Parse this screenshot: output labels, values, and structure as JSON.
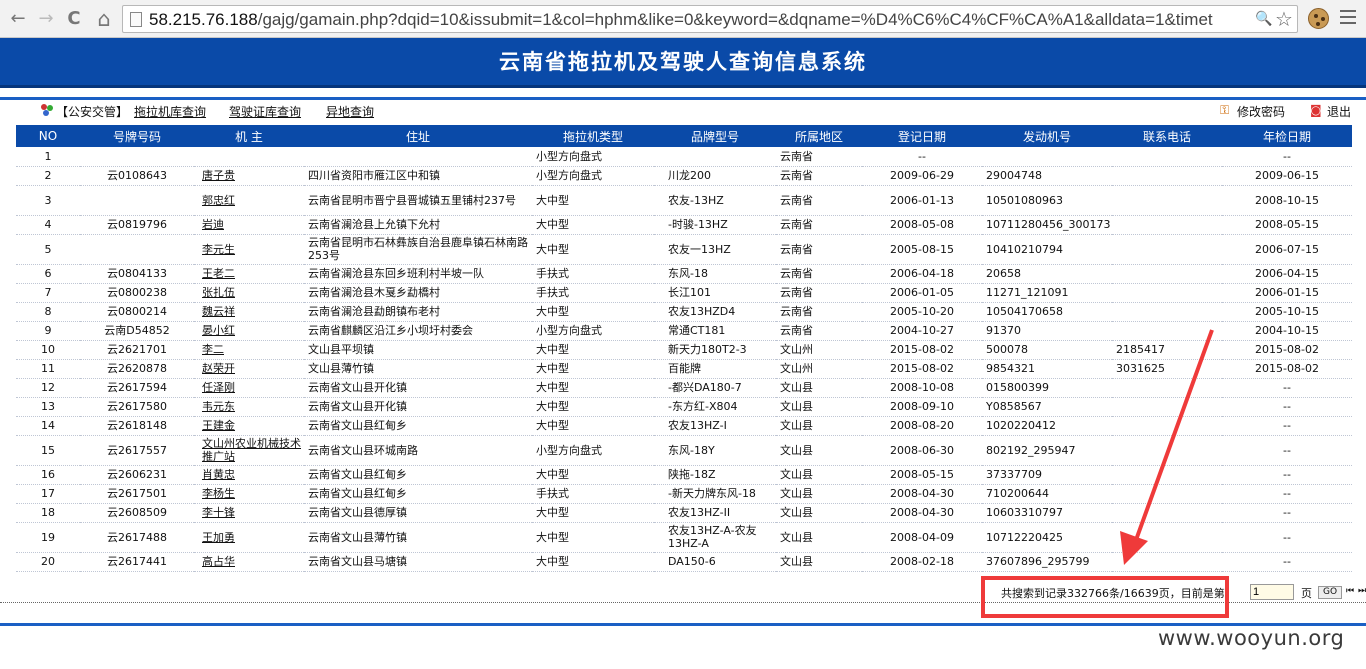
{
  "browser": {
    "url_host": "58.215.76.188",
    "url_rest": "/gajg/gamain.php?dqid=10&issubmit=1&col=hphm&like=0&keyword=&dqname=%D4%C6%C4%CF%CA%A1&alldata=1&timet",
    "back_glyph": "←",
    "forward_glyph": "→",
    "reload_glyph": "C",
    "home_glyph": "⌂",
    "search_glyph": "🔍",
    "star_glyph": "☆"
  },
  "banner": {
    "title": "云南省拖拉机及驾驶人查询信息系统"
  },
  "nav": {
    "prefix": "【公安交管】",
    "links": [
      "拖拉机库查询",
      "驾驶证库查询",
      "异地查询"
    ],
    "change_password": "修改密码",
    "logout": "退出"
  },
  "table": {
    "headers": [
      "NO",
      "号牌号码",
      "机 主",
      "住址",
      "拖拉机类型",
      "品牌型号",
      "所属地区",
      "登记日期",
      "发动机号",
      "联系电话",
      "年检日期"
    ],
    "rows": [
      [
        "1",
        "",
        "",
        "",
        "小型方向盘式",
        "",
        "云南省",
        "--",
        "",
        "",
        "--"
      ],
      [
        "2",
        "云0108643",
        "唐子贵",
        "四川省资阳市雁江区中和镇",
        "小型方向盘式",
        "川龙200",
        "云南省",
        "2009-06-29",
        "29004748",
        "",
        "2009-06-15"
      ],
      [
        "3",
        "",
        "郭忠红",
        "云南省昆明市晋宁县晋城镇五里铺村237号",
        "大中型",
        "农友-13HZ",
        "云南省",
        "2006-01-13",
        "10501080963",
        "",
        "2008-10-15"
      ],
      [
        "4",
        "云0819796",
        "岩迪",
        "云南省澜沧县上允镇下允村",
        "大中型",
        "-时骏-13HZ",
        "云南省",
        "2008-05-08",
        "10711280456_300173",
        "",
        "2008-05-15"
      ],
      [
        "5",
        "",
        "李元生",
        "云南省昆明市石林彝族自治县鹿阜镇石林南路253号",
        "大中型",
        "农友一13HZ",
        "云南省",
        "2005-08-15",
        "10410210794",
        "",
        "2006-07-15"
      ],
      [
        "6",
        "云0804133",
        "王老二",
        "云南省澜沧县东回乡班利村半坡一队",
        "手扶式",
        "东风-18",
        "云南省",
        "2006-04-18",
        "20658",
        "",
        "2006-04-15"
      ],
      [
        "7",
        "云0800238",
        "张扎伍",
        "云南省澜沧县木戛乡勐橋村",
        "手扶式",
        "长江101",
        "云南省",
        "2006-01-05",
        "11271_121091",
        "",
        "2006-01-15"
      ],
      [
        "8",
        "云0800214",
        "魏云祥",
        "云南省澜沧县勐朗镇布老村",
        "大中型",
        "农友13HZD4",
        "云南省",
        "2005-10-20",
        "10504170658",
        "",
        "2005-10-15"
      ],
      [
        "9",
        "云南D54852",
        "晏小红",
        "云南省麒麟区沿江乡小坝圩村委会",
        "小型方向盘式",
        "常通CT181",
        "云南省",
        "2004-10-27",
        "91370",
        "",
        "2004-10-15"
      ],
      [
        "10",
        "云2621701",
        "李二",
        "文山县平坝镇",
        "大中型",
        "新天力180T2-3",
        "文山州",
        "2015-08-02",
        "500078",
        "2185417",
        "2015-08-02"
      ],
      [
        "11",
        "云2620878",
        "赵荣开",
        "文山县薄竹镇",
        "大中型",
        "百能牌",
        "文山州",
        "2015-08-02",
        "9854321",
        "3031625",
        "2015-08-02"
      ],
      [
        "12",
        "云2617594",
        "任泽刚",
        "云南省文山县开化镇",
        "大中型",
        "-都兴DA180-7",
        "文山县",
        "2008-10-08",
        "015800399",
        "",
        "--"
      ],
      [
        "13",
        "云2617580",
        "韦元东",
        "云南省文山县开化镇",
        "大中型",
        "-东方红-X804",
        "文山县",
        "2008-09-10",
        "Y0858567",
        "",
        "--"
      ],
      [
        "14",
        "云2618148",
        "王建金",
        "云南省文山县红甸乡",
        "大中型",
        "农友13HZ-I",
        "文山县",
        "2008-08-20",
        "1020220412",
        "",
        "--"
      ],
      [
        "15",
        "云2617557",
        "文山州农业机械技术推广站",
        "云南省文山县环城南路",
        "小型方向盘式",
        "东风-18Y",
        "文山县",
        "2008-06-30",
        "802192_295947",
        "",
        "--"
      ],
      [
        "16",
        "云2606231",
        "肖黄忠",
        "云南省文山县红甸乡",
        "大中型",
        "陕拖-18Z",
        "文山县",
        "2008-05-15",
        "37337709",
        "",
        "--"
      ],
      [
        "17",
        "云2617501",
        "李杨生",
        "云南省文山县红甸乡",
        "手扶式",
        "-新天力牌东风-18",
        "文山县",
        "2008-04-30",
        "710200644",
        "",
        "--"
      ],
      [
        "18",
        "云2608509",
        "李十锋",
        "云南省文山县德厚镇",
        "大中型",
        "农友13HZ-II",
        "文山县",
        "2008-04-30",
        "10603310797",
        "",
        "--"
      ],
      [
        "19",
        "云2617488",
        "王加勇",
        "云南省文山县薄竹镇",
        "大中型",
        "农友13HZ-A-农友13HZ-A",
        "文山县",
        "2008-04-09",
        "10712220425",
        "",
        "--"
      ],
      [
        "20",
        "云2617441",
        "高占华",
        "云南省文山县马塘镇",
        "大中型",
        "DA150-6",
        "文山县",
        "2008-02-18",
        "37607896_295799",
        "",
        "--"
      ]
    ]
  },
  "pager": {
    "summary": "共搜索到记录332766条/16639页，目前是第",
    "page_value": "1",
    "page_unit": "页",
    "go_label": "GO",
    "first_glyph": "⏮",
    "last_glyph": "⏭"
  },
  "watermark": "www.wooyun.org",
  "colors": {
    "banner": "#0a4aa8",
    "highlight": "#ef3a3a"
  }
}
